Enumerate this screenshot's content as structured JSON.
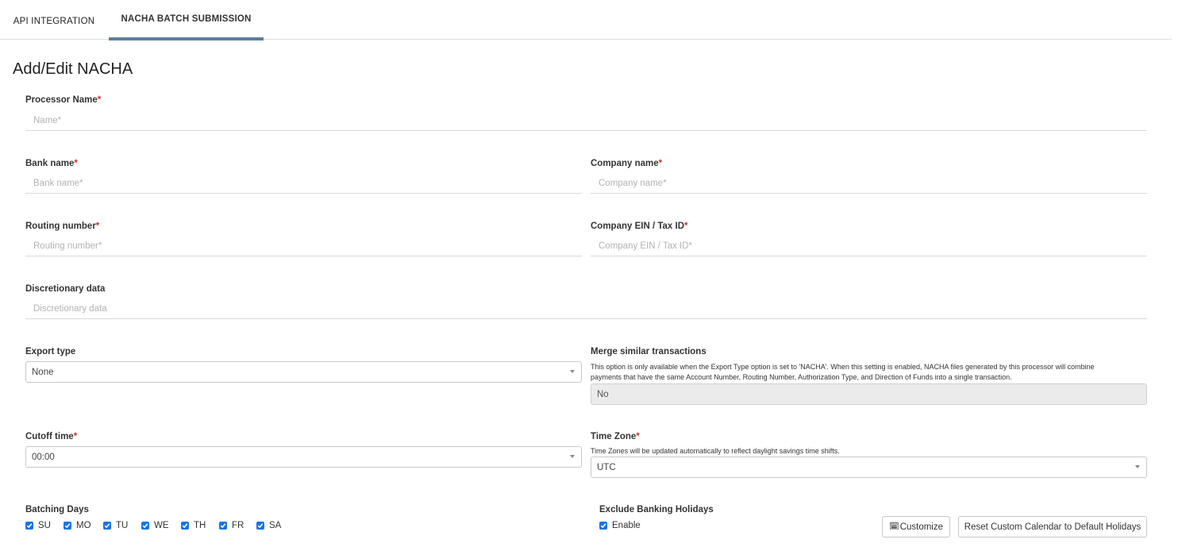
{
  "tabs": [
    {
      "label": "API INTEGRATION"
    },
    {
      "label": "NACHA BATCH SUBMISSION"
    }
  ],
  "page_title": "Add/Edit NACHA",
  "required_mark": "*",
  "processor_name": {
    "label": "Processor Name",
    "placeholder": "Name*",
    "value": ""
  },
  "bank_name": {
    "label": "Bank name",
    "placeholder": "Bank name*",
    "value": ""
  },
  "company_name": {
    "label": "Company name",
    "placeholder": "Company name*",
    "value": ""
  },
  "routing_number": {
    "label": "Routing number",
    "placeholder": "Routing number*",
    "value": ""
  },
  "company_ein": {
    "label": "Company EIN / Tax ID",
    "placeholder": "Company EIN / Tax ID*",
    "value": ""
  },
  "discretionary_data": {
    "label": "Discretionary data",
    "placeholder": "Discretionary data",
    "value": ""
  },
  "export_type": {
    "label": "Export type",
    "value": "None"
  },
  "merge_similar": {
    "label": "Merge similar transactions",
    "help_line1": "This option is only available when the Export Type option is set to 'NACHA'. When this setting is enabled, NACHA files generated by this processor will combine",
    "help_line2": "payments that have the same Account Number, Routing Number, Authorization Type, and Direction of Funds into a single transaction.",
    "value": "No"
  },
  "cutoff_time": {
    "label": "Cutoff time",
    "value": "00:00"
  },
  "time_zone": {
    "label": "Time Zone",
    "help": "Time Zones will be updated automatically to reflect daylight savings time shifts.",
    "value": "UTC"
  },
  "batching_days": {
    "label": "Batching Days",
    "days": [
      {
        "label": "SU",
        "checked": true
      },
      {
        "label": "MO",
        "checked": true
      },
      {
        "label": "TU",
        "checked": true
      },
      {
        "label": "WE",
        "checked": true
      },
      {
        "label": "TH",
        "checked": true
      },
      {
        "label": "FR",
        "checked": true
      },
      {
        "label": "SA",
        "checked": true
      }
    ]
  },
  "exclude_holidays": {
    "label": "Exclude Banking Holidays",
    "enable_label": "Enable",
    "checked": true
  },
  "buttons": {
    "customize": "Customize",
    "reset": "Reset Custom Calendar to Default Holidays"
  },
  "colors": {
    "accent": "#5b7fa0",
    "checkbox": "#1a73e8",
    "required": "#c9302c"
  }
}
